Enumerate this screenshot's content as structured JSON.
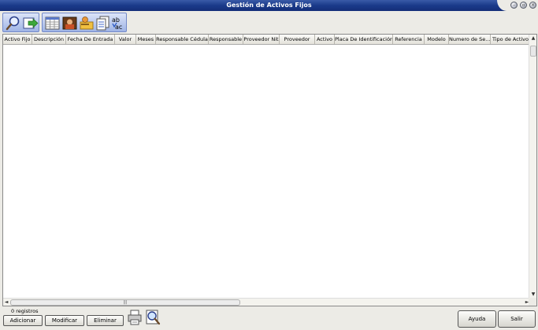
{
  "window": {
    "title": "Gestión de Activos Fijos"
  },
  "grid": {
    "columns": [
      "Activo Fijo",
      "Descripción",
      "Fecha De Entrada",
      "Valor",
      "Meses",
      "Responsable Cédula",
      "Responsable",
      "Proveedor Nit",
      "Proveedor",
      "Activo",
      "Placa De Identificación",
      "Referencia",
      "Modelo",
      "Numero de Se...",
      "Tipo de Activo"
    ],
    "rows": []
  },
  "status": {
    "record_count": "0 registros"
  },
  "buttons": {
    "add": "Adicionar",
    "modify": "Modificar",
    "delete": "Eliminar",
    "help": "Ayuda",
    "exit": "Salir"
  },
  "icons": {
    "search": "magnifier-icon",
    "export": "export-arrow-icon",
    "grid_view": "grid-view-icon",
    "photo": "photo-icon",
    "user_card": "user-card-icon",
    "documents": "documents-icon",
    "spellcheck": "spellcheck-icon",
    "print": "printer-icon",
    "preview": "print-preview-icon"
  }
}
